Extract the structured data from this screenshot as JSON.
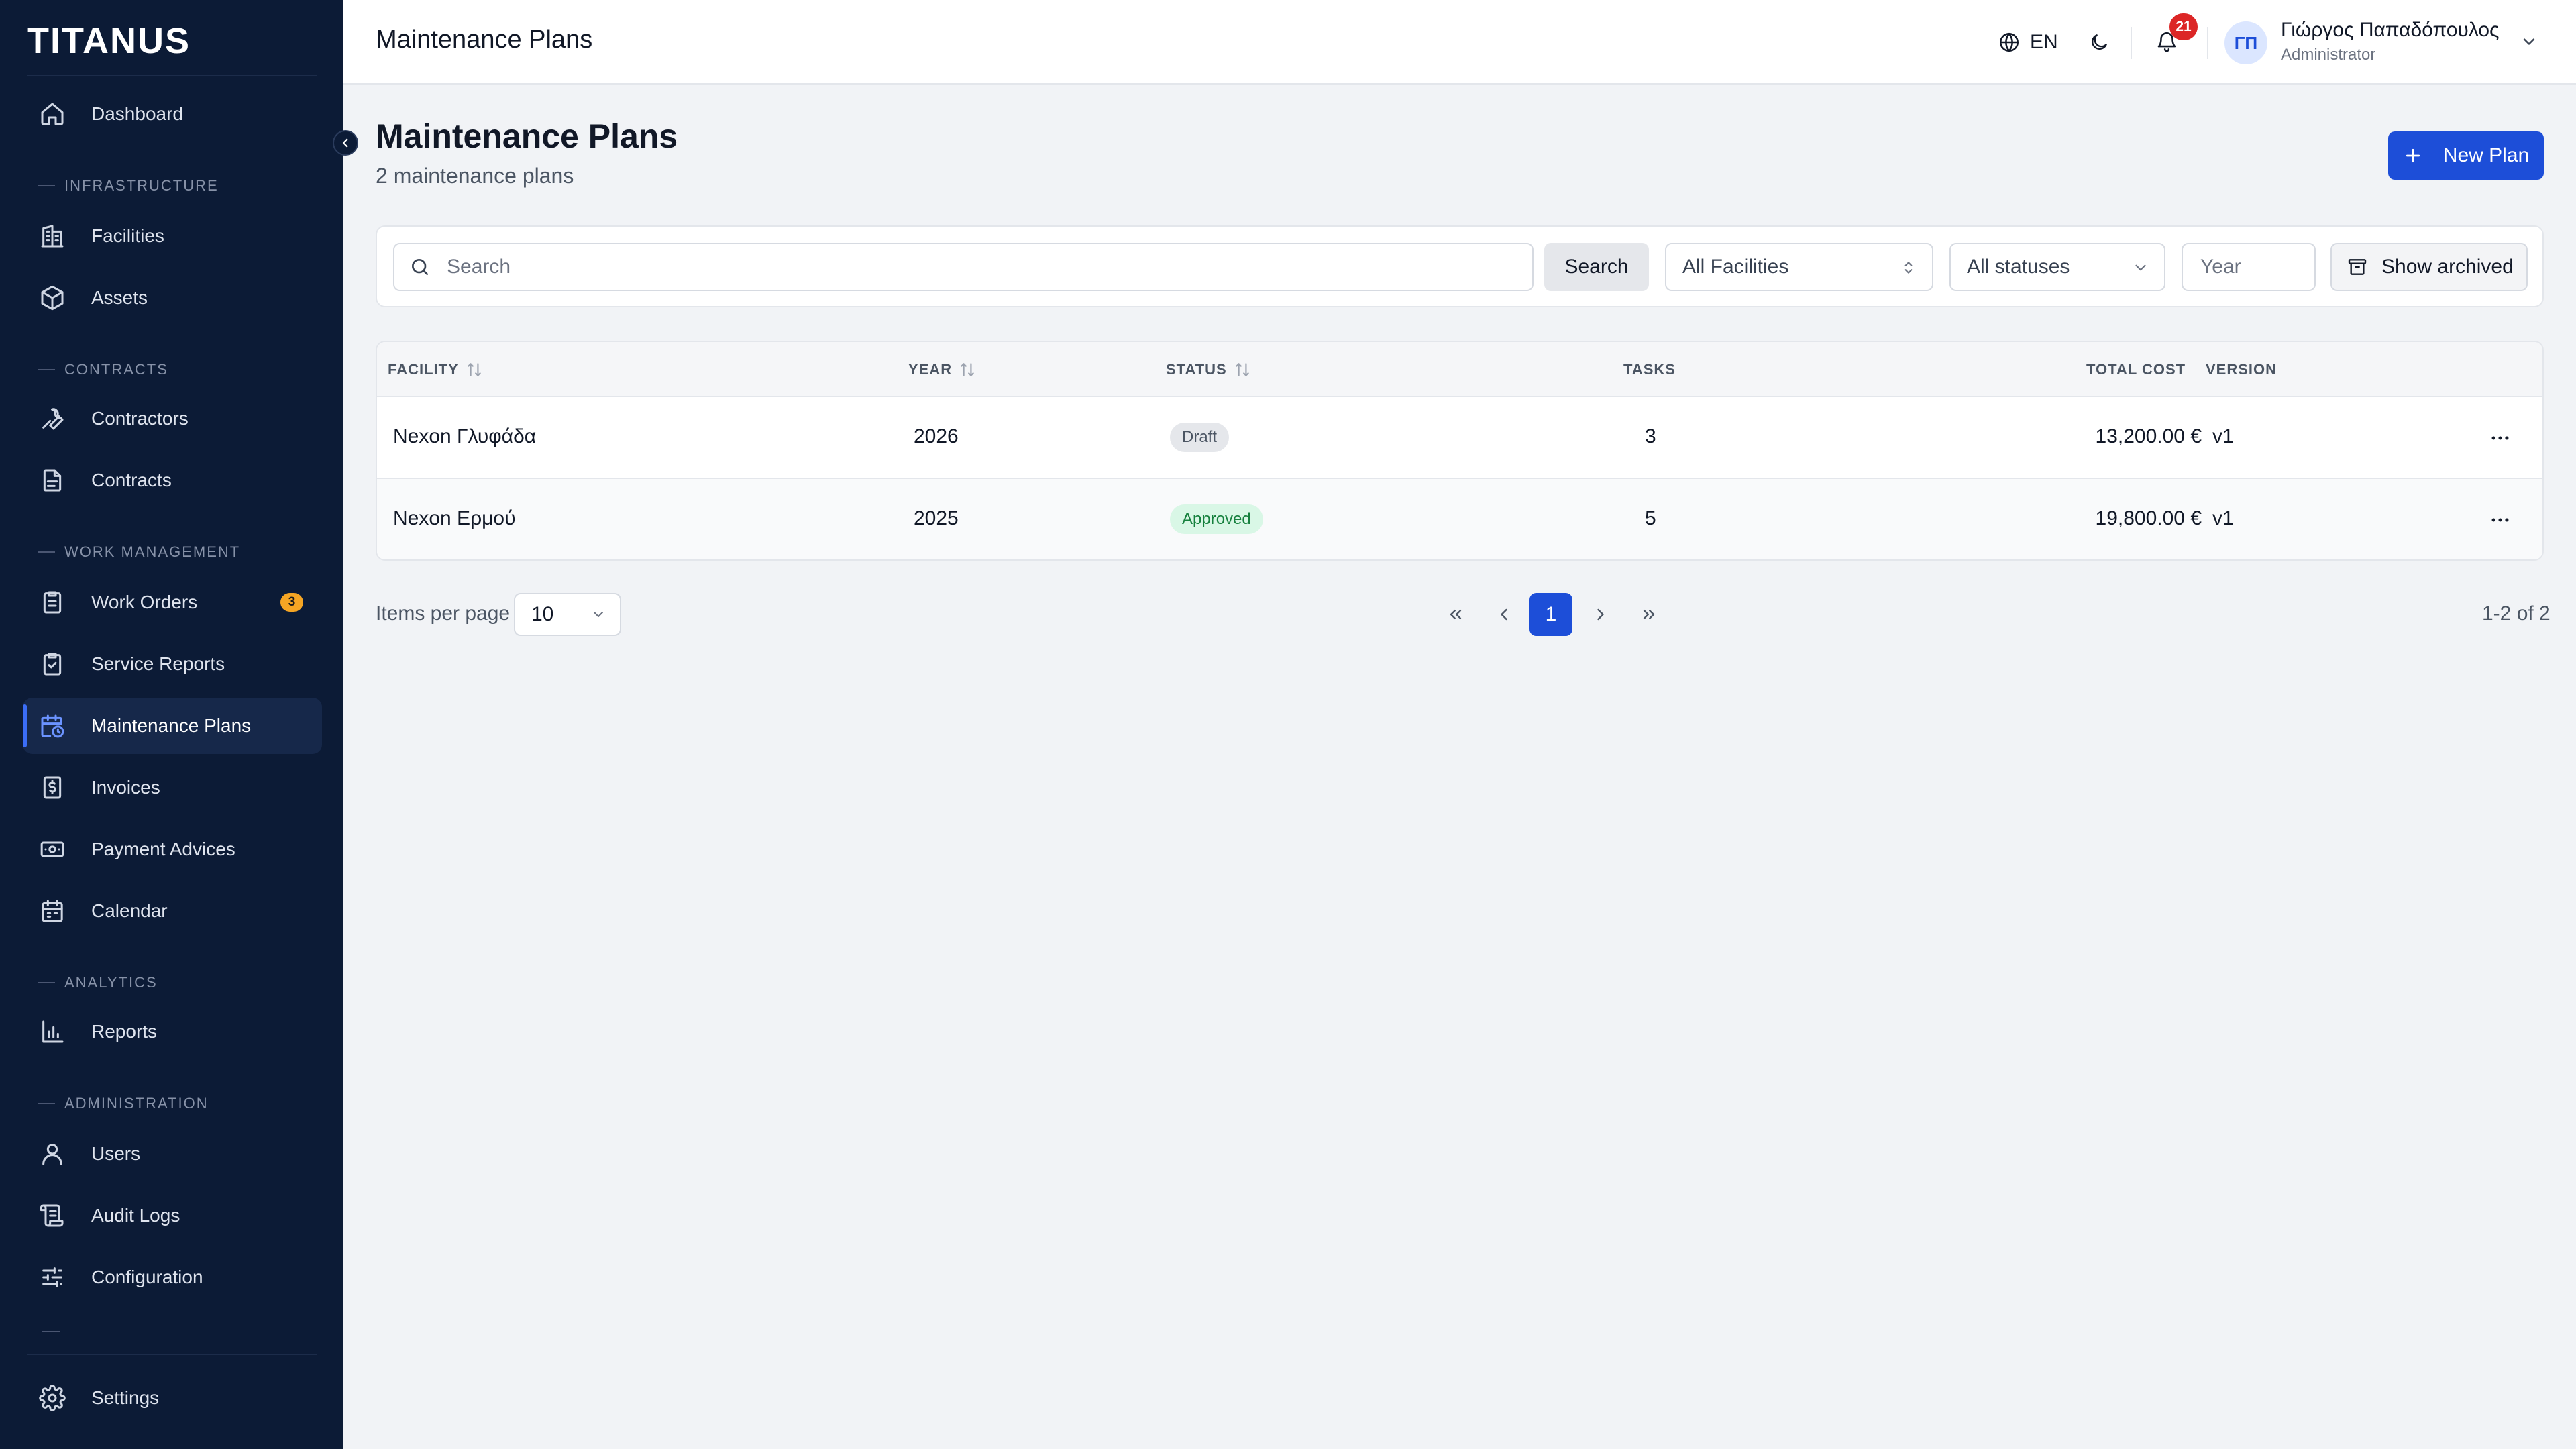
{
  "brand": {
    "logo": "TITANUS"
  },
  "sidebar": {
    "dashboard": "Dashboard",
    "sections": {
      "infrastructure": "INFRASTRUCTURE",
      "contracts": "CONTRACTS",
      "work_management": "WORK MANAGEMENT",
      "analytics": "ANALYTICS",
      "administration": "ADMINISTRATION"
    },
    "items": {
      "facilities": "Facilities",
      "assets": "Assets",
      "contractors": "Contractors",
      "contracts": "Contracts",
      "work_orders": "Work Orders",
      "work_orders_badge": "3",
      "service_reports": "Service Reports",
      "maintenance_plans": "Maintenance Plans",
      "invoices": "Invoices",
      "payment_advices": "Payment Advices",
      "calendar": "Calendar",
      "reports": "Reports",
      "users": "Users",
      "audit_logs": "Audit Logs",
      "configuration": "Configuration",
      "settings": "Settings"
    },
    "active_item": "maintenance_plans"
  },
  "header": {
    "title": "Maintenance Plans",
    "language": "EN",
    "notification_count": "21",
    "user": {
      "initials": "ΓΠ",
      "name": "Γιώργος Παπαδόπουλος",
      "role": "Administrator"
    }
  },
  "main": {
    "title": "Maintenance Plans",
    "subtitle": "2 maintenance plans",
    "new_button": "New Plan",
    "filters": {
      "search_placeholder": "Search",
      "search_button": "Search",
      "facility": "All Facilities",
      "status": "All statuses",
      "year_placeholder": "Year",
      "archived_button": "Show archived"
    },
    "table": {
      "columns": {
        "facility": "FACILITY",
        "year": "YEAR",
        "status": "STATUS",
        "tasks": "TASKS",
        "total_cost": "TOTAL COST",
        "version": "VERSION"
      },
      "rows": [
        {
          "facility": "Nexon Γλυφάδα",
          "year": "2026",
          "status": "Draft",
          "tasks": "3",
          "total_cost": "13,200.00 €",
          "version": "v1"
        },
        {
          "facility": "Nexon Ερμού",
          "year": "2025",
          "status": "Approved",
          "tasks": "5",
          "total_cost": "19,800.00 €",
          "version": "v1"
        }
      ]
    },
    "pagination": {
      "items_per_page_label": "Items per page",
      "items_per_page": "10",
      "current_page": "1",
      "range": "1-2 of 2"
    }
  },
  "colors": {
    "sidebar_bg": "#0c1b36",
    "primary": "#1d4ed8",
    "badge_warning": "#f5a524",
    "notification": "#dc2626",
    "approved_bg": "#d9f7e6",
    "draft_bg": "#e5e7eb"
  },
  "icons": {
    "dashboard": "home-icon",
    "facilities": "building-icon",
    "assets": "box-icon",
    "contractors": "wrench-icon",
    "contracts": "document-icon",
    "work_orders": "clipboard-list-icon",
    "service_reports": "clipboard-check-icon",
    "maintenance_plans": "calendar-clock-icon",
    "invoices": "receipt-icon",
    "payment_advices": "banknote-icon",
    "calendar": "calendar-icon",
    "reports": "bar-chart-icon",
    "users": "user-icon",
    "audit_logs": "scroll-icon",
    "configuration": "sliders-icon",
    "settings": "gear-icon"
  }
}
